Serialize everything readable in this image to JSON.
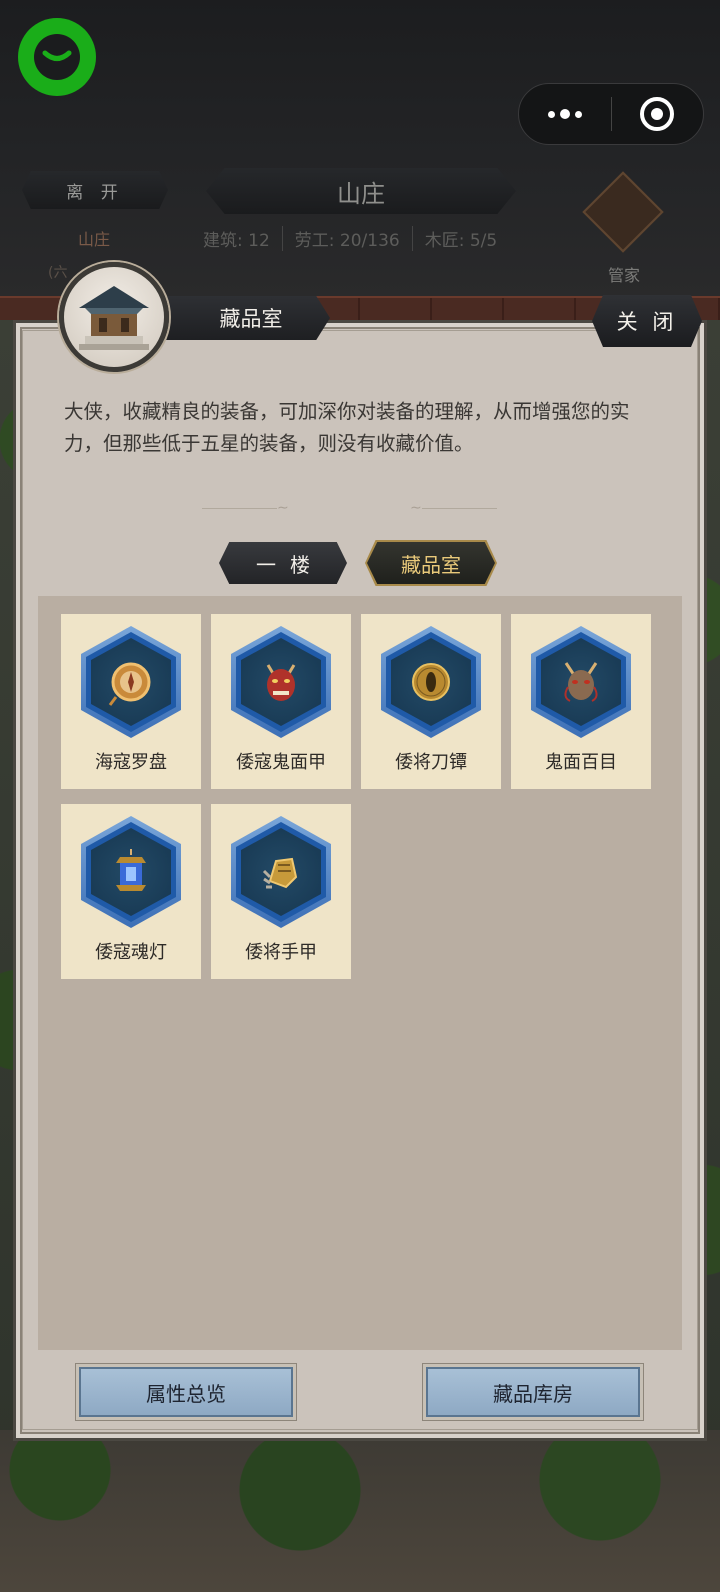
{
  "header": {
    "leave_label": "离 开",
    "estate_link": "山庄",
    "estate_sub": "(六",
    "title": "山庄",
    "stats": [
      {
        "label": "建筑: 12"
      },
      {
        "label": "劳工: 20/136"
      },
      {
        "label": "木匠: 5/5"
      }
    ],
    "steward_label": "管家"
  },
  "panel": {
    "room_title": "藏品室",
    "close_label": "关 闭",
    "description": "大侠，收藏精良的装备，可加深你对装备的理解，从而增强您的实力，但那些低于五星的装备，则没有收藏价值。",
    "tabs": [
      {
        "label": "一楼",
        "active": false
      },
      {
        "label": "藏品室",
        "active": true
      }
    ],
    "items": [
      {
        "name": "海寇罗盘",
        "icon": "compass-icon"
      },
      {
        "name": "倭寇鬼面甲",
        "icon": "oni-mask-armor-icon"
      },
      {
        "name": "倭将刀镡",
        "icon": "sword-guard-icon"
      },
      {
        "name": "鬼面百目",
        "icon": "demon-mask-icon"
      },
      {
        "name": "倭寇魂灯",
        "icon": "spirit-lantern-icon"
      },
      {
        "name": "倭将手甲",
        "icon": "gauntlet-icon"
      }
    ],
    "buttons": {
      "attributes": "属性总览",
      "storage": "藏品库房"
    }
  },
  "colors": {
    "panel_bg": "#cbc3bb",
    "item_bg": "#efe4c8",
    "hex_blue": "#1f5aa8",
    "tab_active_text": "#e9c97a",
    "brand_green": "#1aad19"
  }
}
